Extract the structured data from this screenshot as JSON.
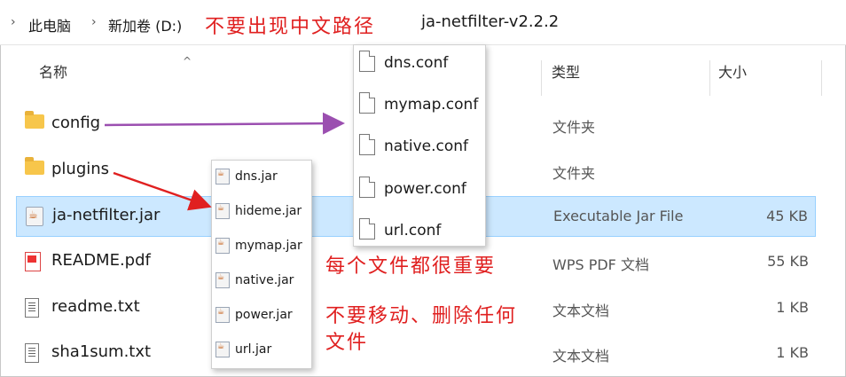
{
  "address_bar": {
    "crumbs": [
      "此电脑",
      "新加卷 (D:)"
    ],
    "warning": "不要出现中文路径",
    "current_folder": "ja-netfilter-v2.2.2"
  },
  "columns": {
    "name": "名称",
    "type": "类型",
    "size": "大小"
  },
  "files": [
    {
      "name": "config",
      "type": "文件夹",
      "size": ""
    },
    {
      "name": "plugins",
      "type": "文件夹",
      "size": ""
    },
    {
      "name": "ja-netfilter.jar",
      "type": "Executable Jar File",
      "size": "45 KB"
    },
    {
      "name": "README.pdf",
      "type": "WPS PDF 文档",
      "size": "55 KB"
    },
    {
      "name": "readme.txt",
      "type": "文本文档",
      "size": "1 KB"
    },
    {
      "name": "sha1sum.txt",
      "type": "文本文档",
      "size": "1 KB"
    }
  ],
  "config_files": [
    "dns.conf",
    "mymap.conf",
    "native.conf",
    "power.conf",
    "url.conf"
  ],
  "plugin_files": [
    "dns.jar",
    "hideme.jar",
    "mymap.jar",
    "native.jar",
    "power.jar",
    "url.jar"
  ],
  "notes": {
    "important": "每个文件都很重要",
    "dont_move": "不要移动、删除任何文件"
  },
  "colors": {
    "annotation_red": "#e02020",
    "arrow_purple": "#9b4fb0",
    "selection": "#cce8ff"
  }
}
